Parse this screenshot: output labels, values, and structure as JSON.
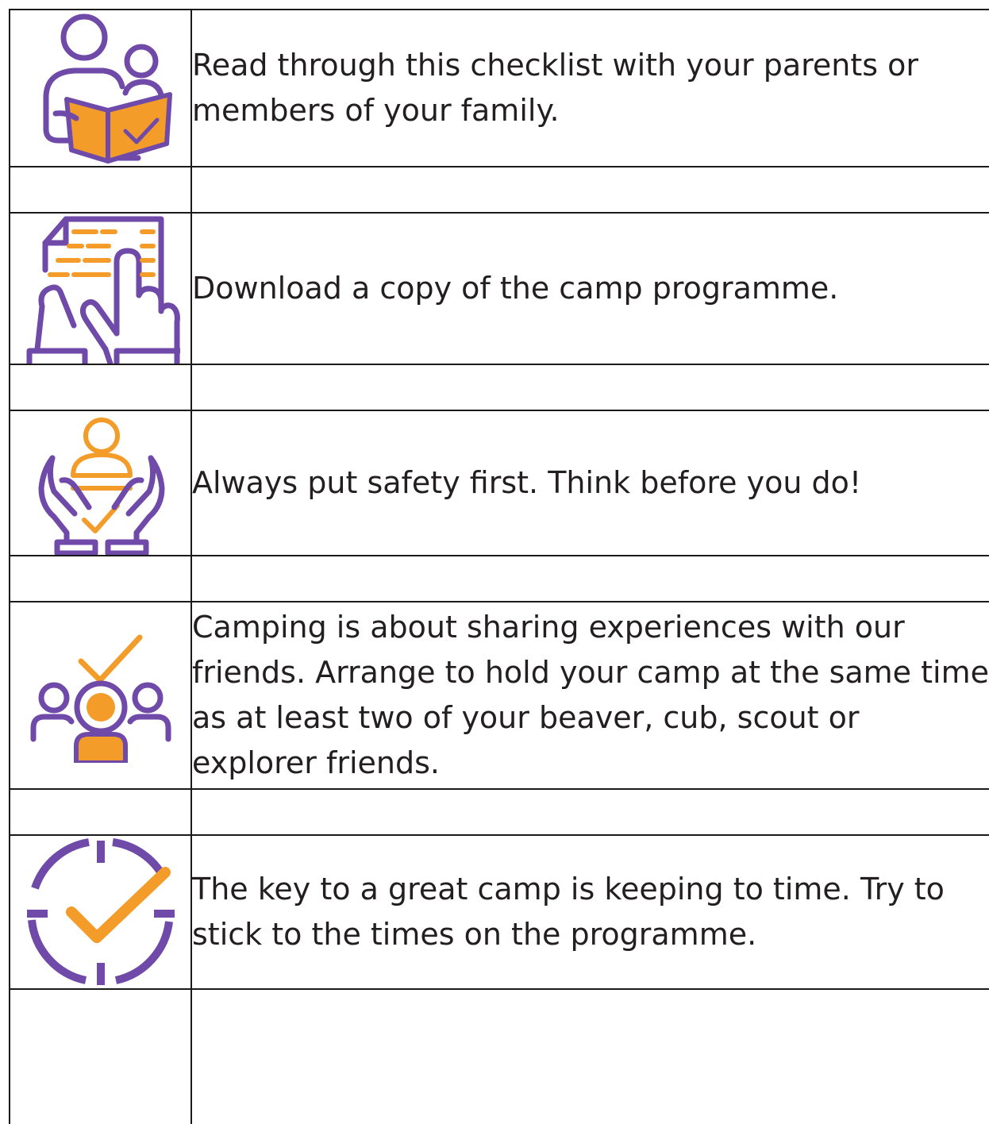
{
  "colors": {
    "purple": "#6f4aa8",
    "orange": "#f39c2a",
    "border": "#1a1a1a"
  },
  "items": [
    {
      "icon": "reading-book-icon",
      "text": "Read through this checklist with your parents or members of your family."
    },
    {
      "icon": "document-hand-icon",
      "text": "Download a copy of the camp programme."
    },
    {
      "icon": "safety-hands-icon",
      "text": "Always put safety first. Think before you do!"
    },
    {
      "icon": "group-friends-icon",
      "text": "Camping is about sharing experiences with our friends. Arrange to hold your camp at the same time as at least two of your beaver, cub, scout or explorer friends."
    },
    {
      "icon": "clock-check-icon",
      "text": "The key to a great camp is keeping to time. Try to stick to the times on the programme."
    }
  ]
}
